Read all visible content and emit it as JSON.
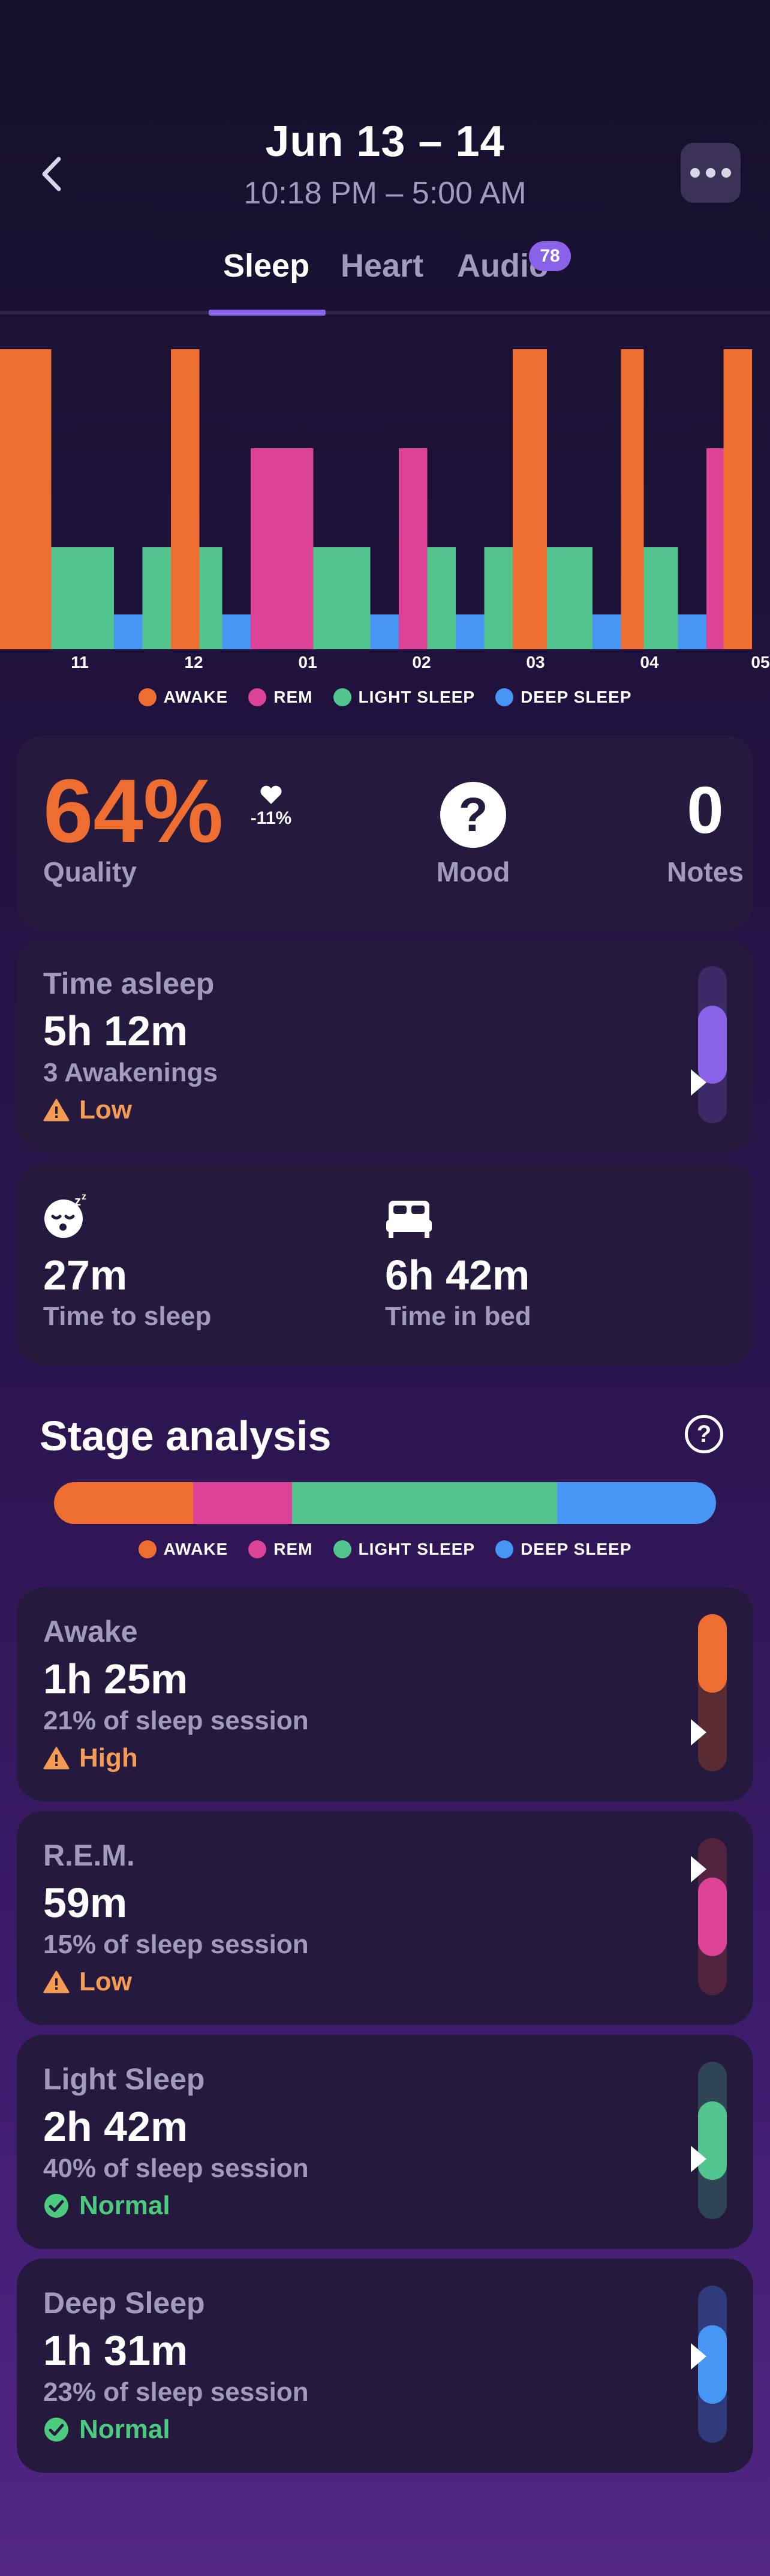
{
  "header": {
    "title": "Jun 13 – 14",
    "subtitle": "10:18 PM – 5:00 AM",
    "back_icon": "chevron-left-icon",
    "more_icon": "ellipsis-icon"
  },
  "tabs": [
    {
      "label": "Sleep",
      "active": true
    },
    {
      "label": "Heart",
      "active": false
    },
    {
      "label": "Audio",
      "active": false,
      "badge": "78"
    }
  ],
  "colors": {
    "awake": "#ee6d31",
    "rem": "#dc4396",
    "light": "#52c48d",
    "deep": "#4795f5",
    "warning": "#f49b54",
    "normal": "#4ccb7f",
    "accent": "#8a62e8"
  },
  "legend": [
    "AWAKE",
    "REM",
    "LIGHT SLEEP",
    "DEEP SLEEP"
  ],
  "chart_data": {
    "type": "bar",
    "x_ticks": [
      "11",
      "12",
      "01",
      "02",
      "03",
      "04",
      "05"
    ],
    "stages": [
      "AWAKE",
      "REM",
      "LIGHT SLEEP",
      "DEEP SLEEP"
    ],
    "segments": [
      {
        "stage": "AWAKE",
        "start": 0.0,
        "end": 0.45
      },
      {
        "stage": "LIGHT SLEEP",
        "start": 0.45,
        "end": 1.0
      },
      {
        "stage": "DEEP SLEEP",
        "start": 1.0,
        "end": 1.25
      },
      {
        "stage": "LIGHT SLEEP",
        "start": 1.25,
        "end": 1.5
      },
      {
        "stage": "AWAKE",
        "start": 1.5,
        "end": 1.75
      },
      {
        "stage": "LIGHT SLEEP",
        "start": 1.75,
        "end": 1.95
      },
      {
        "stage": "DEEP SLEEP",
        "start": 1.95,
        "end": 2.2
      },
      {
        "stage": "REM",
        "start": 2.2,
        "end": 2.75
      },
      {
        "stage": "LIGHT SLEEP",
        "start": 2.75,
        "end": 3.25
      },
      {
        "stage": "DEEP SLEEP",
        "start": 3.25,
        "end": 3.5
      },
      {
        "stage": "REM",
        "start": 3.5,
        "end": 3.75
      },
      {
        "stage": "LIGHT SLEEP",
        "start": 3.75,
        "end": 4.0
      },
      {
        "stage": "DEEP SLEEP",
        "start": 4.0,
        "end": 4.25
      },
      {
        "stage": "LIGHT SLEEP",
        "start": 4.25,
        "end": 4.5
      },
      {
        "stage": "AWAKE",
        "start": 4.5,
        "end": 4.8
      },
      {
        "stage": "LIGHT SLEEP",
        "start": 4.8,
        "end": 5.2
      },
      {
        "stage": "DEEP SLEEP",
        "start": 5.2,
        "end": 5.45
      },
      {
        "stage": "AWAKE",
        "start": 5.45,
        "end": 5.65
      },
      {
        "stage": "LIGHT SLEEP",
        "start": 5.65,
        "end": 5.95
      },
      {
        "stage": "DEEP SLEEP",
        "start": 5.95,
        "end": 6.2
      },
      {
        "stage": "REM",
        "start": 6.2,
        "end": 6.35
      },
      {
        "stage": "AWAKE",
        "start": 6.35,
        "end": 6.6
      }
    ]
  },
  "summary": {
    "quality_value": "64%",
    "quality_label": "Quality",
    "quality_change": "-11%",
    "mood_icon": "question-mark-icon",
    "mood_label": "Mood",
    "notes_value": "0",
    "notes_label": "Notes"
  },
  "time_asleep": {
    "label": "Time asleep",
    "value": "5h 12m",
    "detail": "3 Awakenings",
    "status": "Low",
    "level": 0.2
  },
  "times": {
    "to_sleep_value": "27m",
    "to_sleep_label": "Time to sleep",
    "in_bed_value": "6h 42m",
    "in_bed_label": "Time in bed"
  },
  "stage_analysis": {
    "title": "Stage analysis",
    "help_icon": "question-mark-icon",
    "proportions": [
      {
        "stage": "AWAKE",
        "percent": 21
      },
      {
        "stage": "REM",
        "percent": 15
      },
      {
        "stage": "LIGHT SLEEP",
        "percent": 40
      },
      {
        "stage": "DEEP SLEEP",
        "percent": 24
      }
    ]
  },
  "stages": [
    {
      "label": "Awake",
      "value": "1h 25m",
      "detail": "21% of sleep session",
      "status": "High",
      "status_type": "warning",
      "color": "#ee6d31",
      "track": "#5a2c33",
      "marker": 0.75,
      "fill_from": 0.0,
      "fill_to": 0.5
    },
    {
      "label": "R.E.M.",
      "value": "59m",
      "detail": "15% of sleep session",
      "status": "Low",
      "status_type": "warning",
      "color": "#dc4396",
      "track": "#51233f",
      "marker": 0.2,
      "fill_from": 0.25,
      "fill_to": 0.75
    },
    {
      "label": "Light Sleep",
      "value": "2h 42m",
      "detail": "40% of sleep session",
      "status": "Normal",
      "status_type": "normal",
      "color": "#52c48d",
      "track": "#2f4454",
      "marker": 0.62,
      "fill_from": 0.25,
      "fill_to": 0.75
    },
    {
      "label": "Deep Sleep",
      "value": "1h 31m",
      "detail": "23% of sleep session",
      "status": "Normal",
      "status_type": "normal",
      "color": "#4795f5",
      "track": "#2e3a7a",
      "marker": 0.45,
      "fill_from": 0.25,
      "fill_to": 0.75
    }
  ]
}
